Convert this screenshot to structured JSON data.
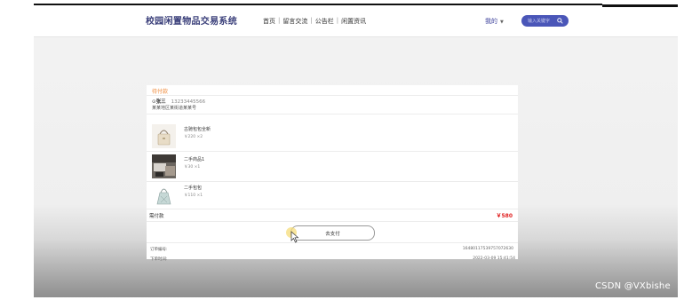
{
  "header": {
    "logo": "校园闲置物品交易系统",
    "nav": [
      "首页",
      "留言交流",
      "公告栏",
      "闲置资讯"
    ],
    "mine": "我的",
    "search_placeholder": "输入关键字",
    "colors": {
      "brand": "#3a3f7a",
      "search_bg": "#4a56b8"
    }
  },
  "order": {
    "status": "待付款",
    "address": {
      "name": "张三",
      "phone": "13233445566",
      "detail": "某某地区某街道某某号"
    },
    "items": [
      {
        "name": "古驰包包全新",
        "price_qty": "￥220 ×2",
        "icon": "handbag-image"
      },
      {
        "name": "二手商品1",
        "price_qty": "￥30 ×1",
        "icon": "product-photo"
      },
      {
        "name": "二手包包",
        "price_qty": "￥110 ×1",
        "icon": "bag-image"
      }
    ],
    "total_label": "需付款",
    "total_value": "￥580",
    "pay_button": "去支付",
    "order_no_label": "订单编号:",
    "order_no": "16480117539757072630",
    "order_time_label": "下单时间:",
    "order_time": "2022-03-09 15:41:54",
    "colors": {
      "status": "#f08a3a",
      "total": "#e01f1f"
    }
  },
  "watermark": "CSDN @VXbishe"
}
